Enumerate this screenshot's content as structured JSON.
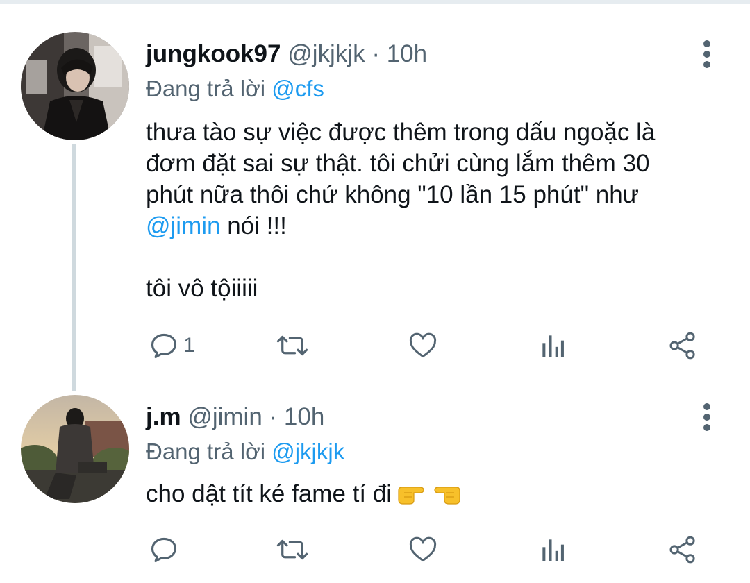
{
  "tweets": [
    {
      "display_name": "jungkook97",
      "handle": "@jkjkjk",
      "separator": "·",
      "time": "10h",
      "replying_prefix": "Đang trả lời",
      "replying_to": "@cfs",
      "body_lines": [
        "thưa tào sự việc được thêm trong dấu ngoặc là",
        "đơm đặt sai sự thật. tôi chửi cùng lắm thêm 30",
        "phút nữa thôi chứ không \"10 lần 15 phút\" như"
      ],
      "body_mention": "@jimin",
      "body_mention_suffix": " nói !!!",
      "body_last": "tôi vô tộiiiii",
      "reply_count": "1"
    },
    {
      "display_name": "j.m",
      "handle": "@jimin",
      "separator": "·",
      "time": "10h",
      "replying_prefix": "Đang trả lời",
      "replying_to": "@jkjkjk",
      "body_text": "cho dật tít ké fame tí đi",
      "emojis": [
        "backhand-index-pointing-right",
        "backhand-index-pointing-left"
      ],
      "reply_count": ""
    }
  ],
  "colors": {
    "text": "#0f1419",
    "secondary": "#536471",
    "link": "#1d9bf0",
    "thread_line": "#cfd9de"
  },
  "icons": [
    "reply-icon",
    "retweet-icon",
    "like-icon",
    "stats-icon",
    "share-icon",
    "more-icon"
  ]
}
